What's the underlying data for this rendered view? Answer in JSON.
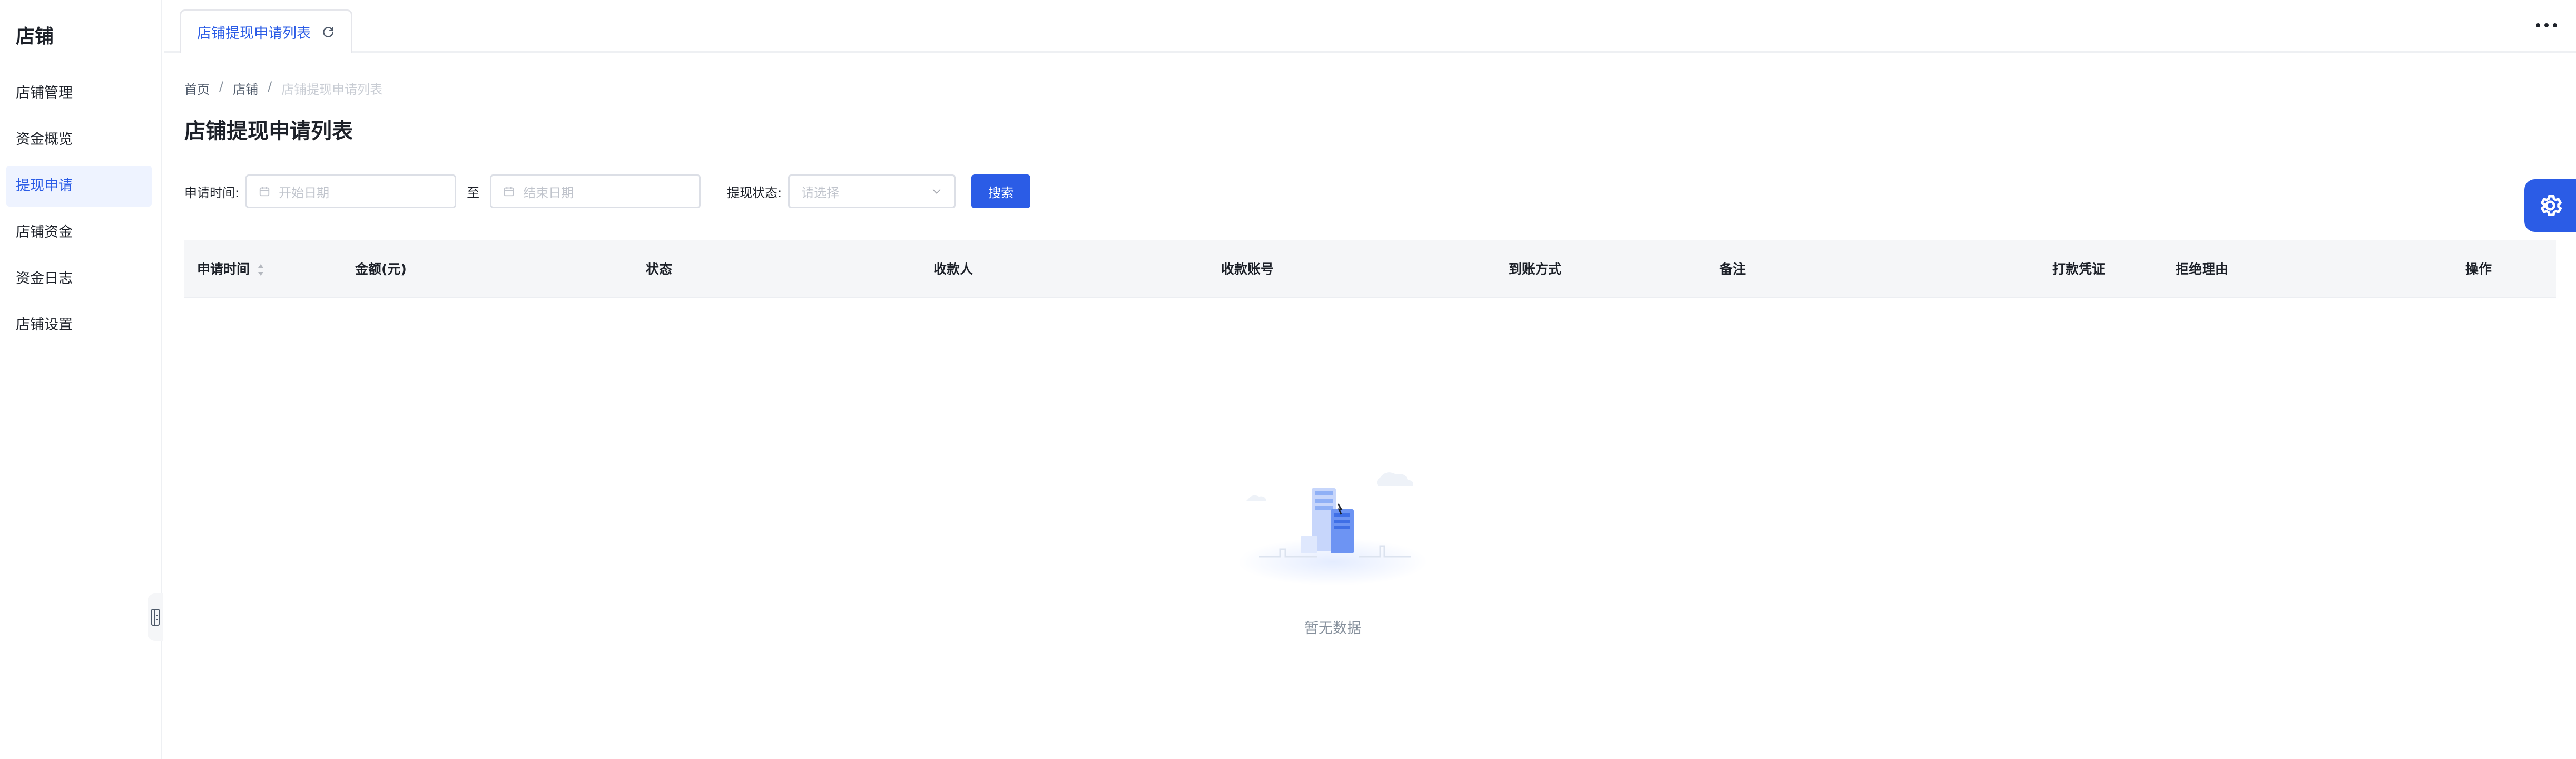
{
  "sidebar": {
    "brand": "店铺",
    "items": [
      {
        "label": "店铺管理"
      },
      {
        "label": "资金概览"
      },
      {
        "label": "提现申请"
      },
      {
        "label": "店铺资金"
      },
      {
        "label": "资金日志"
      },
      {
        "label": "店铺设置"
      }
    ],
    "active_index": 2
  },
  "tabs": [
    {
      "label": "店铺提现申请列表",
      "icons": [
        "refresh-icon"
      ]
    }
  ],
  "header": {
    "more_icon": "more-dots-icon"
  },
  "breadcrumb": [
    "首页",
    "店铺",
    "店铺提现申请列表"
  ],
  "page_title": "店铺提现申请列表",
  "filters": {
    "date_label": "申请时间:",
    "start_placeholder": "开始日期",
    "range_sep": "至",
    "end_placeholder": "结束日期",
    "status_label": "提现状态:",
    "status_placeholder": "请选择",
    "search_button": "搜索"
  },
  "table": {
    "columns": [
      "申请时间",
      "金额(元)",
      "状态",
      "收款人",
      "收款账号",
      "到账方式",
      "备注",
      "打款凭证",
      "拒绝理由",
      "操作"
    ],
    "rows": []
  },
  "empty": {
    "text": "暂无数据"
  },
  "colors": {
    "accent": "#2b5ce6",
    "active_bg": "#eef3ff"
  }
}
